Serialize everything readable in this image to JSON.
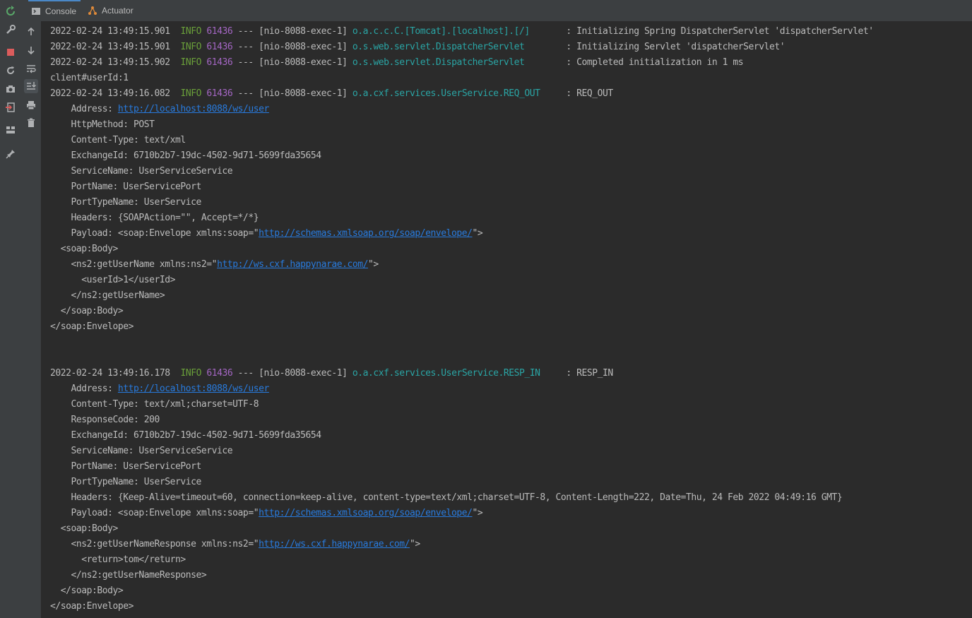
{
  "tabs": [
    {
      "label": "Console",
      "icon": "console-icon",
      "selected": true
    },
    {
      "label": "Actuator",
      "icon": "actuator-icon",
      "selected": false
    }
  ],
  "left_toolbar": [
    "rerun-icon",
    "wrench-icon",
    "stop-icon",
    "restore-icon",
    "camera-icon",
    "exit-icon",
    "layout-icon",
    "pin-icon"
  ],
  "console_toolbar": [
    "arrow-up-icon",
    "arrow-down-icon",
    "soft-wrap-icon",
    "scroll-to-end-icon",
    "print-icon",
    "trash-icon"
  ],
  "log": {
    "l1": {
      "ts": "2022-02-24 13:49:15.901",
      "level": "INFO",
      "pid": "61436",
      "mid": " --- [nio-8088-exec-1] ",
      "logger": "o.a.c.c.C.[Tomcat].[localhost].[/]      ",
      "msg": " : Initializing Spring DispatcherServlet 'dispatcherServlet'"
    },
    "l2": {
      "ts": "2022-02-24 13:49:15.901",
      "level": "INFO",
      "pid": "61436",
      "mid": " --- [nio-8088-exec-1] ",
      "logger": "o.s.web.servlet.DispatcherServlet       ",
      "msg": " : Initializing Servlet 'dispatcherServlet'"
    },
    "l3": {
      "ts": "2022-02-24 13:49:15.902",
      "level": "INFO",
      "pid": "61436",
      "mid": " --- [nio-8088-exec-1] ",
      "logger": "o.s.web.servlet.DispatcherServlet       ",
      "msg": " : Completed initialization in 1 ms"
    },
    "l4": {
      "text": "client#userId:1"
    },
    "l5": {
      "ts": "2022-02-24 13:49:16.082",
      "level": "INFO",
      "pid": "61436",
      "mid": " --- [nio-8088-exec-1] ",
      "logger": "o.a.cxf.services.UserService.REQ_OUT    ",
      "msg": " : REQ_OUT"
    },
    "req": {
      "address_label": "    Address: ",
      "address_url": "http://localhost:8088/ws/user",
      "method": "    HttpMethod: POST",
      "ctype": "    Content-Type: text/xml",
      "exid": "    ExchangeId: 6710b2b7-19dc-4502-9d71-5699fda35654",
      "sname": "    ServiceName: UserServiceService",
      "pname": "    PortName: UserServicePort",
      "ptname": "    PortTypeName: UserService",
      "headers": "    Headers: {SOAPAction=\"\", Accept=*/*}",
      "payload_pre": "    Payload: <soap:Envelope xmlns:soap=\"",
      "payload_url": "http://schemas.xmlsoap.org/soap/envelope/",
      "payload_post": "\">",
      "body_open": "  <soap:Body>",
      "op_pre": "    <ns2:getUserName xmlns:ns2=\"",
      "op_url": "http://ws.cxf.happynarae.com/",
      "op_post": "\">",
      "arg": "      <userId>1</userId>",
      "op_close": "    </ns2:getUserName>",
      "body_close": "  </soap:Body>",
      "env_close": "</soap:Envelope>"
    },
    "l6": {
      "ts": "2022-02-24 13:49:16.178",
      "level": "INFO",
      "pid": "61436",
      "mid": " --- [nio-8088-exec-1] ",
      "logger": "o.a.cxf.services.UserService.RESP_IN    ",
      "msg": " : RESP_IN"
    },
    "resp": {
      "address_label": "    Address: ",
      "address_url": "http://localhost:8088/ws/user",
      "ctype": "    Content-Type: text/xml;charset=UTF-8",
      "code": "    ResponseCode: 200",
      "exid": "    ExchangeId: 6710b2b7-19dc-4502-9d71-5699fda35654",
      "sname": "    ServiceName: UserServiceService",
      "pname": "    PortName: UserServicePort",
      "ptname": "    PortTypeName: UserService",
      "headers": "    Headers: {Keep-Alive=timeout=60, connection=keep-alive, content-type=text/xml;charset=UTF-8, Content-Length=222, Date=Thu, 24 Feb 2022 04:49:16 GMT}",
      "payload_pre": "    Payload: <soap:Envelope xmlns:soap=\"",
      "payload_url": "http://schemas.xmlsoap.org/soap/envelope/",
      "payload_post": "\">",
      "body_open": "  <soap:Body>",
      "op_pre": "    <ns2:getUserNameResponse xmlns:ns2=\"",
      "op_url": "http://ws.cxf.happynarae.com/",
      "op_post": "\">",
      "ret": "      <return>tom</return>",
      "op_close": "    </ns2:getUserNameResponse>",
      "body_close": "  </soap:Body>",
      "env_close": "</soap:Envelope>"
    }
  },
  "colors": {
    "level": "#6a9f3a",
    "pid": "#a567c5",
    "logger": "#2aa5a5",
    "link": "#287bde",
    "text": "#bbbbbb",
    "background": "#2b2b2b"
  }
}
